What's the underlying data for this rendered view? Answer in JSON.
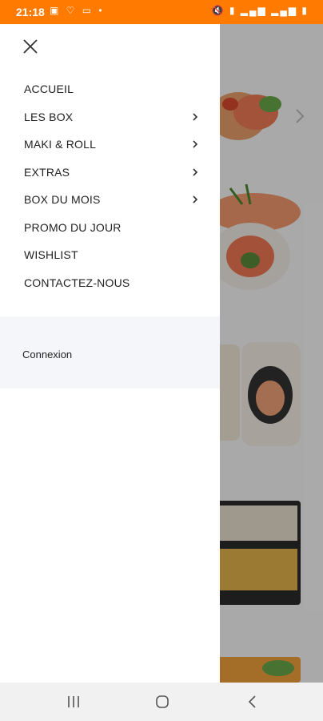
{
  "status_bar": {
    "time": "21:18",
    "left_icons": "▣ ♡ ▭ •",
    "right_icons": "🔇 ▮ ▂▄▆ ▂▄▆ ▮"
  },
  "drawer": {
    "menu_items": [
      {
        "label": "ACCUEIL",
        "has_submenu": false
      },
      {
        "label": "LES BOX",
        "has_submenu": true
      },
      {
        "label": "MAKI & ROLL",
        "has_submenu": true
      },
      {
        "label": "EXTRAS",
        "has_submenu": true
      },
      {
        "label": "BOX DU MOIS",
        "has_submenu": true
      },
      {
        "label": "PROMO DU JOUR",
        "has_submenu": false
      },
      {
        "label": "WISHLIST",
        "has_submenu": false
      },
      {
        "label": "CONTACTEZ-NOUS",
        "has_submenu": false
      }
    ],
    "login_label": "Connexion"
  },
  "colors": {
    "status_bar": "#ff7a00",
    "drawer_bg": "#ffffff",
    "login_band": "#f4f6fa"
  },
  "icons": {
    "close": "close-icon",
    "chevron": "chevron-right-icon",
    "recents": "recents-icon",
    "home": "home-icon",
    "back": "back-icon"
  }
}
